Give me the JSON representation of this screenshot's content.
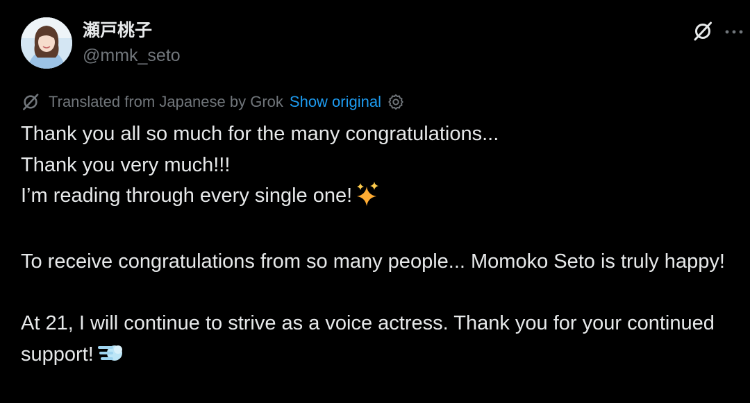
{
  "author": {
    "display_name": "瀬戸桃子",
    "handle": "@mmk_seto"
  },
  "header": {
    "grok_icon": "grok-icon",
    "more_icon": "more-dots-icon"
  },
  "translation": {
    "note": "Translated from Japanese by Grok",
    "show_original_label": "Show original",
    "settings_icon": "gear-icon"
  },
  "tweet": {
    "line1": "Thank you all so much for the many congratulations...",
    "line2": "Thank you very much!!!",
    "line3": "I’m reading through every single one!",
    "line3_emoji": "sparkles",
    "para2": "To receive congratulations from so many people... Momoko Seto is truly happy!",
    "para3": "At 21, I will continue to strive as a voice actress. Thank you for your continued support!",
    "para3_emoji": "dash"
  },
  "colors": {
    "background": "#000000",
    "text": "#e7e9ea",
    "secondary": "#71767b",
    "link": "#1d9bf0"
  }
}
